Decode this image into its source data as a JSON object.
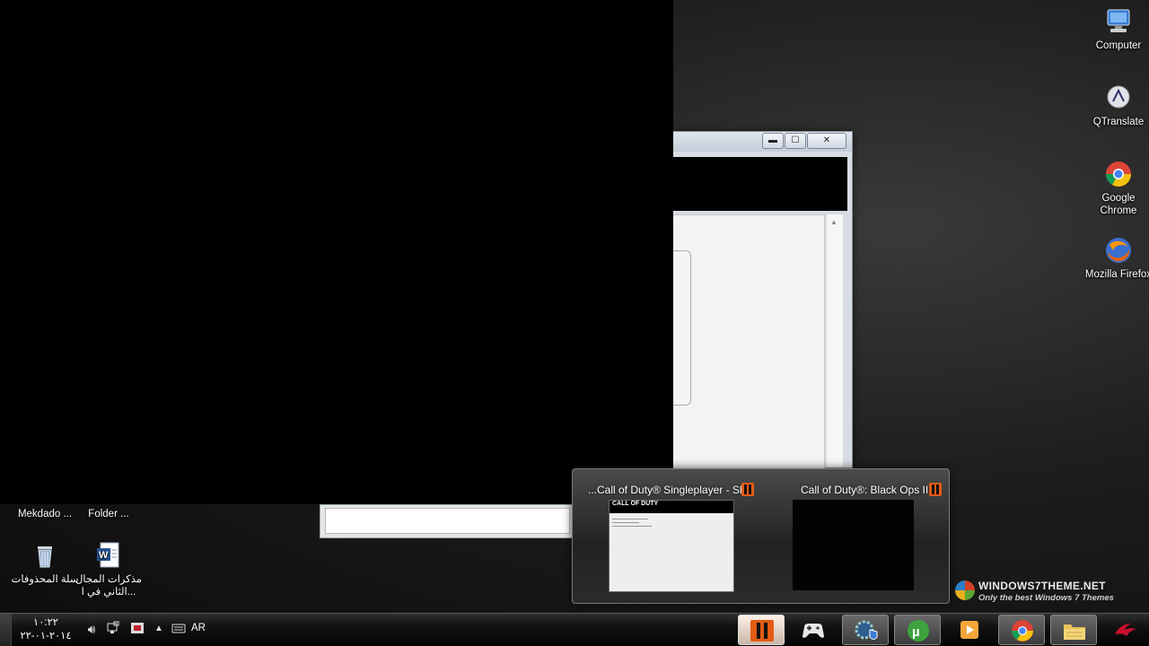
{
  "desktop": {
    "right_icons": [
      {
        "name": "computer",
        "label": "Computer",
        "icon": "computer-icon"
      },
      {
        "name": "qtranslate",
        "label": "QTranslate",
        "icon": "qtranslate-icon"
      },
      {
        "name": "chrome",
        "label": "Google Chrome",
        "icon": "chrome-icon"
      },
      {
        "name": "firefox",
        "label": "Mozilla Firefox",
        "icon": "firefox-icon"
      }
    ],
    "left_icons": [
      {
        "name": "mekdado",
        "label": "Mekdado ...",
        "icon": "shortcut-icon"
      },
      {
        "name": "folder",
        "label": "Folder ...",
        "icon": "folder-icon"
      },
      {
        "name": "recycle-bin",
        "label": "سلة المحذوفات",
        "icon": "recycle-bin-icon"
      },
      {
        "name": "word-doc",
        "label": "مذكرات المجال الثاني في ا...",
        "icon": "word-doc-icon"
      }
    ]
  },
  "window": {
    "minimize": "▬",
    "maximize": "☐",
    "close": "✕"
  },
  "thumbnails": [
    {
      "title": "...Call of Duty® Singleplayer - Shi",
      "badge": "cod-bo2-icon",
      "preview_logo": "CALL OF DUTY"
    },
    {
      "title": "Call of Duty®: Black Ops II",
      "badge": "cod-bo2-icon"
    }
  ],
  "watermark": {
    "title": "WINDOWS7THEME.NET",
    "subtitle": "Only the best Windows 7 Themes"
  },
  "taskbar": {
    "clock_time": "١٠:٢٢",
    "clock_date": "٢٠١٤-٠١-٢٢",
    "language": "AR",
    "tray_icons": [
      "volume-icon",
      "network-icon",
      "flag-icon",
      "show-hidden-icons-icon",
      "keyboard-icon"
    ],
    "buttons": [
      {
        "name": "cod-bo2",
        "icon": "cod-bo2-icon",
        "state": "hot"
      },
      {
        "name": "game-controller",
        "icon": "gamepad-icon",
        "state": "normal"
      },
      {
        "name": "security-tool",
        "icon": "gear-shield-icon",
        "state": "active"
      },
      {
        "name": "utorrent",
        "icon": "utorrent-icon",
        "state": "active"
      },
      {
        "name": "media-player",
        "icon": "media-player-icon",
        "state": "normal"
      },
      {
        "name": "chrome",
        "icon": "chrome-icon",
        "state": "active"
      },
      {
        "name": "file-explorer",
        "icon": "folder-icon",
        "state": "active"
      },
      {
        "name": "rog",
        "icon": "rog-icon",
        "state": "normal"
      }
    ]
  }
}
